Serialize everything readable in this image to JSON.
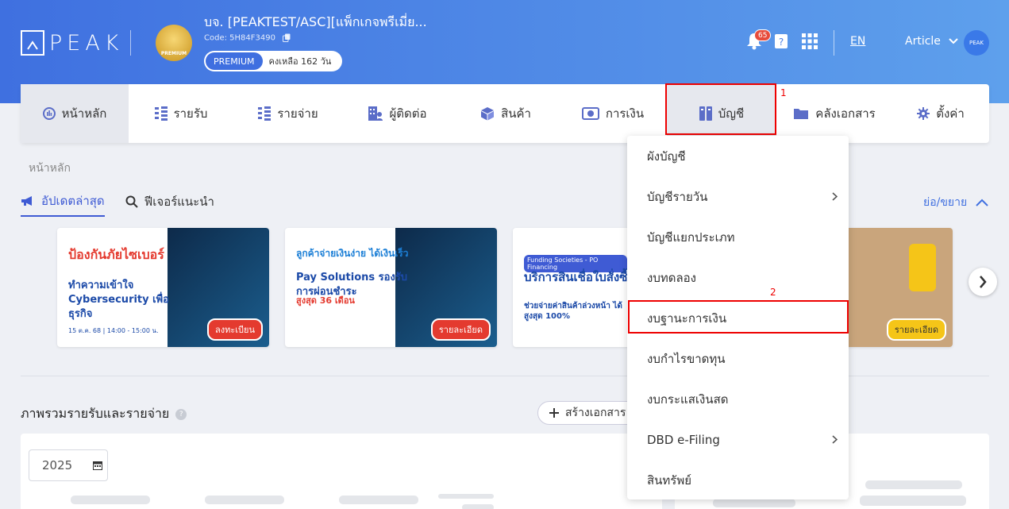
{
  "header": {
    "logo_text": "PEAK",
    "company_title": "บจ. [PEAKTEST/ASC][แพ็กเกจพรีเมี่ย...",
    "company_code": "Code: 5H84F3490",
    "crown_label": "PREMIUM",
    "plan_badge": "PREMIUM",
    "plan_remaining": "คงเหลือ 162 วัน",
    "notification_count": "65",
    "language": "EN",
    "user_name": "Article",
    "avatar_text": "PEAK"
  },
  "nav": {
    "items": [
      {
        "label": "หน้าหลัก",
        "icon": "dashboard-icon"
      },
      {
        "label": "รายรับ",
        "icon": "income-icon"
      },
      {
        "label": "รายจ่าย",
        "icon": "expense-icon"
      },
      {
        "label": "ผู้ติดต่อ",
        "icon": "contacts-icon"
      },
      {
        "label": "สินค้า",
        "icon": "product-box-icon"
      },
      {
        "label": "การเงิน",
        "icon": "money-icon"
      },
      {
        "label": "บัญชี",
        "icon": "ledger-icon"
      },
      {
        "label": "คลังเอกสาร",
        "icon": "folder-icon"
      },
      {
        "label": "ตั้งค่า",
        "icon": "gear-icon"
      }
    ]
  },
  "annotations": {
    "label1": "1",
    "label2": "2"
  },
  "breadcrumb": "หน้าหลัก",
  "tabs": {
    "updates": "อัปเดตล่าสุด",
    "features": "ฟีเจอร์แนะนำ",
    "collapse": "ย่อ/ขยาย"
  },
  "banners": [
    {
      "title": "ป้องกันภัยไซเบอร์",
      "subtitle": "ทำความเข้าใจ Cybersecurity เพื่อธุรกิจ",
      "small": "15 ต.ค. 68 | 14:00 - 15:00 น.",
      "button": "ลงทะเบียน"
    },
    {
      "title": "ลูกค้าจ่ายเงินง่าย ได้เงินเร็ว",
      "subtitle": "Pay Solutions รองรับการผ่อนชำระ",
      "small": "สูงสุด 36 เดือน",
      "button": "รายละเอียด"
    },
    {
      "title": "บริการสินเชื่อใบสั่งซื้อ",
      "subtitle": "ช่วยจ่ายค่าสินค้าล่วงหน้า ได้สูงสุด 100%",
      "small": "Funding Societies - PO Financing",
      "button": ""
    },
    {
      "title": "",
      "subtitle": "",
      "small": "",
      "button": "รายละเอียด"
    }
  ],
  "section": {
    "title": "ภาพรวมรายรับและรายจ่าย",
    "help": "?",
    "create_button": "สร้างเอกสาร",
    "year": "2025"
  },
  "dropdown": {
    "items": [
      {
        "label": "ผังบัญชี",
        "submenu": false
      },
      {
        "label": "บัญชีรายวัน",
        "submenu": true
      },
      {
        "label": "บัญชีแยกประเภท",
        "submenu": false
      },
      {
        "label": "งบทดลอง",
        "submenu": false
      },
      {
        "label": "งบฐานะการเงิน",
        "submenu": false
      },
      {
        "label": "งบกำไรขาดทุน",
        "submenu": false
      },
      {
        "label": "งบกระแสเงินสด",
        "submenu": false
      },
      {
        "label": "DBD e-Filing",
        "submenu": true
      },
      {
        "label": "สินทรัพย์",
        "submenu": false
      }
    ]
  }
}
